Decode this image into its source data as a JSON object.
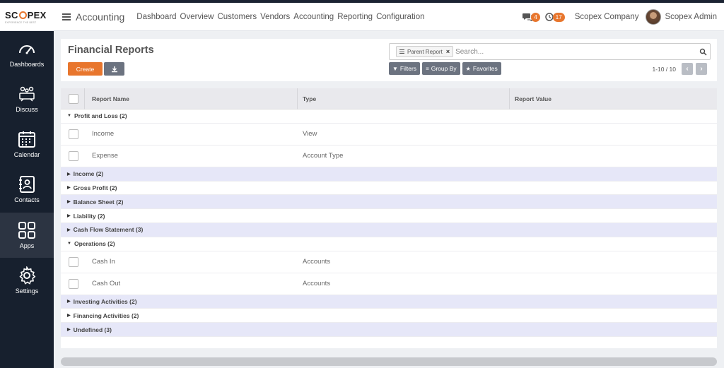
{
  "brand": {
    "logo_left": "SC",
    "logo_right": "PEX",
    "tagline": "EXPERIENCE THE BEST",
    "accent": "#e8762d",
    "sidebar_bg": "#17202e"
  },
  "header": {
    "app_title": "Accounting",
    "nav": [
      "Dashboard",
      "Overview",
      "Customers",
      "Vendors",
      "Accounting",
      "Reporting",
      "Configuration"
    ],
    "messages_count": "4",
    "activities_count": "17",
    "company": "Scopex Company",
    "user": "Scopex Admin"
  },
  "sidebar": {
    "items": [
      {
        "label": "Dashboards",
        "icon": "gauge-icon"
      },
      {
        "label": "Discuss",
        "icon": "discuss-icon"
      },
      {
        "label": "Calendar",
        "icon": "calendar-icon"
      },
      {
        "label": "Contacts",
        "icon": "contacts-icon"
      },
      {
        "label": "Apps",
        "icon": "apps-grid-icon",
        "active": true
      },
      {
        "label": "Settings",
        "icon": "gear-icon"
      }
    ]
  },
  "control_panel": {
    "title": "Financial Reports",
    "create_label": "Create",
    "search_facet": "Parent Report",
    "search_placeholder": "Search...",
    "filters_label": "Filters",
    "groupby_label": "Group By",
    "favorites_label": "Favorites",
    "pager": "1-10 / 10"
  },
  "table": {
    "headers": {
      "name": "Report Name",
      "type": "Type",
      "value": "Report Value"
    },
    "groups": [
      {
        "label": "Profit and Loss (2)",
        "expanded": true,
        "rows": [
          {
            "name": "Income",
            "type": "View"
          },
          {
            "name": "Expense",
            "type": "Account Type"
          }
        ]
      },
      {
        "label": "Income (2)",
        "expanded": false
      },
      {
        "label": "Gross Profit (2)",
        "expanded": false
      },
      {
        "label": "Balance Sheet (2)",
        "expanded": false
      },
      {
        "label": "Liability (2)",
        "expanded": false
      },
      {
        "label": "Cash Flow Statement (3)",
        "expanded": false
      },
      {
        "label": "Operations (2)",
        "expanded": true,
        "rows": [
          {
            "name": "Cash In",
            "type": "Accounts"
          },
          {
            "name": "Cash Out",
            "type": "Accounts"
          }
        ]
      },
      {
        "label": "Investing Activities (2)",
        "expanded": false
      },
      {
        "label": "Financing Activities (2)",
        "expanded": false
      },
      {
        "label": "Undefined (3)",
        "expanded": false
      }
    ]
  }
}
